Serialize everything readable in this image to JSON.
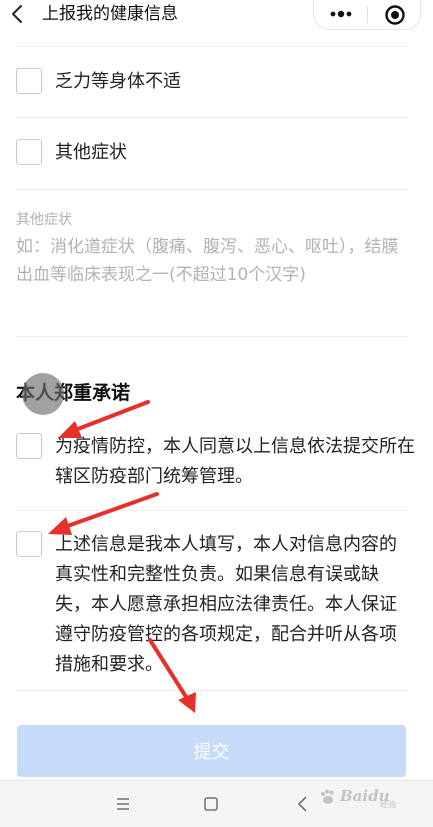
{
  "header": {
    "title": "上报我的健康信息"
  },
  "options": [
    {
      "label": "乏力等身体不适",
      "checked": false
    },
    {
      "label": "其他症状",
      "checked": false
    }
  ],
  "other_symptoms": {
    "label": "其他症状",
    "placeholder": "如：消化道症状（腹痛、腹泻、恶心、呕吐），结膜出血等临床表现之一(不超过10个汉字)"
  },
  "commitment": {
    "title": "本人郑重承诺",
    "items": [
      {
        "text": "为疫情防控，本人同意以上信息依法提交所在辖区防疫部门统筹管理。",
        "checked": false
      },
      {
        "text": "上述信息是我本人填写，本人对信息内容的真实性和完整性负责。如果信息有误或缺失，本人愿意承担相应法律责任。本人保证遵守防疫管控的各项规定，配合并听从各项措施和要求。",
        "checked": false
      }
    ]
  },
  "submit": {
    "label": "提交",
    "enabled": false
  },
  "watermark": {
    "brand": "Bai",
    "brand2": "du",
    "sub": "经验"
  },
  "colors": {
    "submit_disabled": "#c5dbf9",
    "annotation_arrow": "#e8302a",
    "placeholder": "#b2b2b2"
  }
}
